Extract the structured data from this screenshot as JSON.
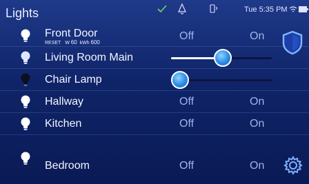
{
  "header": {
    "title": "Lights",
    "clock": "Tue 5:35 PM"
  },
  "icons": {
    "check": "check-icon",
    "bell": "bell-icon",
    "bluetooth": "bluetooth-icon",
    "wifi": "wifi-icon",
    "battery": "battery-icon",
    "shield": "shield-icon",
    "gear": "gear-icon"
  },
  "colors": {
    "accent": "#3a9cf2",
    "check": "#6fdc5a",
    "background": "#12287a"
  },
  "lights": [
    {
      "name": "Front Door",
      "type": "switch",
      "off_label": "Off",
      "on_label": "On",
      "sub": {
        "reset": "RESET",
        "w_label": "W",
        "w_value": "60",
        "kwh_label": "kWh",
        "kwh_value": "600"
      }
    },
    {
      "name": "Living Room Main",
      "type": "dimmer",
      "level": 0.52
    },
    {
      "name": "Chair Lamp",
      "type": "dimmer",
      "level": 0.0
    },
    {
      "name": "Hallway",
      "type": "switch",
      "off_label": "Off",
      "on_label": "On"
    },
    {
      "name": "Kitchen",
      "type": "switch",
      "off_label": "Off",
      "on_label": "On"
    },
    {
      "name": "Bedroom",
      "type": "switch",
      "off_label": "Off",
      "on_label": "On"
    }
  ]
}
